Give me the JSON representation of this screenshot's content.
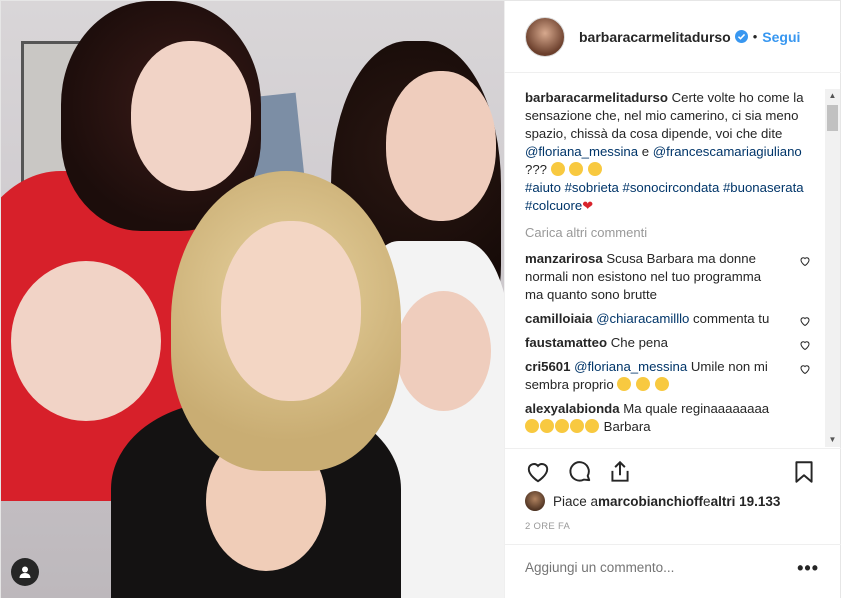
{
  "post": {
    "username": "barbaracarmelitadurso",
    "follow_label": "Segui",
    "separator": "•",
    "caption": {
      "username": "barbaracarmelitadurso",
      "text_1": " Certe volte ho come la sensazione che, nel mio camerino, ci sia meno spazio, chissà da cosa dipende, voi che dite ",
      "mention_1": "@floriana_messina",
      "text_2": " e ",
      "mention_2": "@francescamariagiuliano",
      "text_3": " ??? ",
      "hashtags": "#aiuto #sobrieta #sonocircondata #buonaserata #colcuore",
      "heart": "❤"
    },
    "load_more": "Carica altri commenti",
    "comments": [
      {
        "user": "manzarirosa",
        "text": " Scusa Barbara ma donne normali non esistono nel tuo programma ma quanto sono brutte"
      },
      {
        "user": "camilloiaia",
        "mention": " @chiaracamilllo",
        "text": " commenta tu"
      },
      {
        "user": "faustamatteo",
        "text": " Che pena"
      },
      {
        "user": "cri5601",
        "mention": " @floriana_messina",
        "text": " Umile non mi sembra proprio "
      },
      {
        "user": "alexyalabionda",
        "text": " Ma quale reginaaaaaaaa",
        "text_2": " Barbara"
      }
    ],
    "likes": {
      "prefix": "Piace a ",
      "user": "marcobianchioff",
      "middle": " e ",
      "count": "altri 19.133"
    },
    "time": "2 ORE FA",
    "add_comment_placeholder": "Aggiungi un commento...",
    "more_label": "•••"
  },
  "colors": {
    "link": "#3897f0",
    "hashtag": "#003569",
    "muted": "#999999",
    "red_heart": "#d8242c"
  },
  "icons": [
    "verified-badge-icon",
    "heart-icon",
    "comment-icon",
    "share-icon",
    "bookmark-icon",
    "user-tag-icon",
    "more-icon"
  ]
}
